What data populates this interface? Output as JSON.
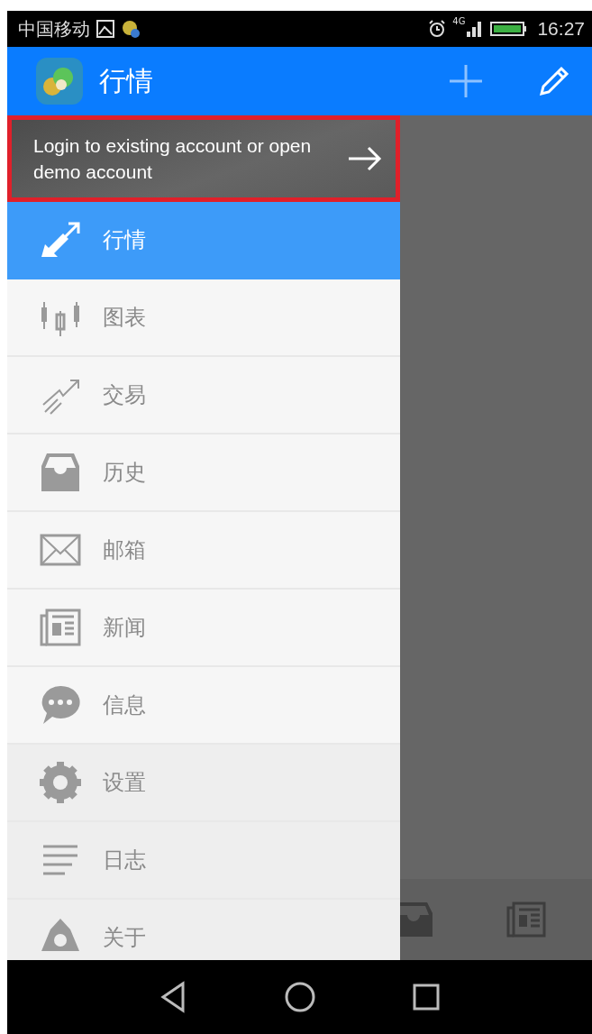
{
  "status_bar": {
    "carrier": "中国移动",
    "network": "4G",
    "time": "16:27"
  },
  "app_bar": {
    "title": "行情"
  },
  "login_banner": {
    "text": "Login to existing account or open demo account",
    "highlighted": true
  },
  "drawer_items": [
    {
      "label": "行情",
      "selected": true,
      "kind": "primary"
    },
    {
      "label": "图表",
      "selected": false,
      "kind": "primary"
    },
    {
      "label": "交易",
      "selected": false,
      "kind": "primary"
    },
    {
      "label": "历史",
      "selected": false,
      "kind": "primary"
    },
    {
      "label": "邮箱",
      "selected": false,
      "kind": "primary"
    },
    {
      "label": "新闻",
      "selected": false,
      "kind": "primary"
    },
    {
      "label": "信息",
      "selected": false,
      "kind": "primary"
    },
    {
      "label": "设置",
      "selected": false,
      "kind": "secondary"
    },
    {
      "label": "日志",
      "selected": false,
      "kind": "secondary"
    },
    {
      "label": "关于",
      "selected": false,
      "kind": "secondary"
    }
  ]
}
